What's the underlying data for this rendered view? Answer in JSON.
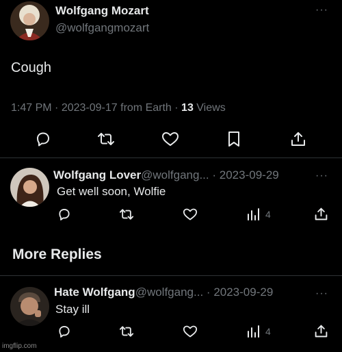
{
  "main_tweet": {
    "author_name": "Wolfgang Mozart",
    "author_handle": "@wolfgangmozart",
    "text": "Cough",
    "time": "1:47 PM",
    "sep1": "·",
    "date": "2023-09-17",
    "source": "from Earth",
    "sep2": "·",
    "views_count": "13",
    "views_label": "Views"
  },
  "replies": [
    {
      "author_name": "Wolfgang Lover",
      "author_handle": "@wolfgang...",
      "sep": "·",
      "date": "2023-09-29",
      "text": "Get well soon, Wolfie",
      "views": "4"
    },
    {
      "author_name": "Hate Wolfgang",
      "author_handle": "@wolfgang...",
      "sep": "·",
      "date": "2023-09-29",
      "text": "Stay ill",
      "views": "4"
    }
  ],
  "section_heading": "More Replies",
  "watermark": "imgflip.com",
  "colors": {
    "background": "#000000",
    "text_primary": "#e7e9ea",
    "text_muted": "#71767b",
    "divider": "#2f3336"
  },
  "icons": [
    "more-icon",
    "reply-icon",
    "retweet-icon",
    "like-icon",
    "bookmark-icon",
    "share-icon",
    "views-icon"
  ]
}
